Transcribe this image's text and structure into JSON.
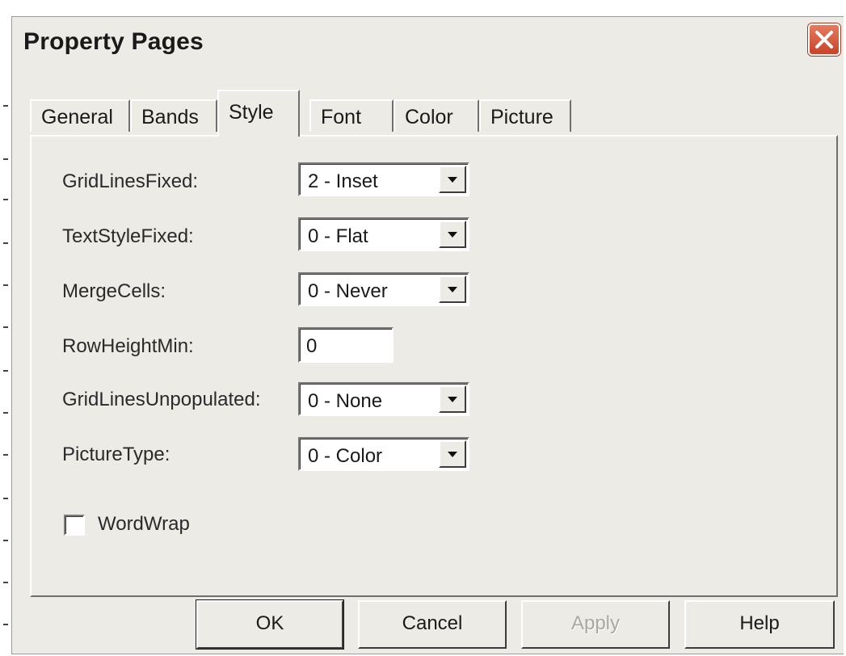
{
  "window": {
    "title": "Property Pages"
  },
  "tabs": [
    {
      "label": "General",
      "active": false
    },
    {
      "label": "Bands",
      "active": false
    },
    {
      "label": "Style",
      "active": true
    },
    {
      "label": "Font",
      "active": false
    },
    {
      "label": "Color",
      "active": false
    },
    {
      "label": "Picture",
      "active": false
    }
  ],
  "style_page": {
    "grid_lines_fixed": {
      "label": "GridLinesFixed:",
      "value": "2 - Inset"
    },
    "text_style_fixed": {
      "label": "TextStyleFixed:",
      "value": "0 - Flat"
    },
    "merge_cells": {
      "label": "MergeCells:",
      "value": "0 - Never"
    },
    "row_height_min": {
      "label": "RowHeightMin:",
      "value": "0"
    },
    "grid_lines_unpopulated": {
      "label": "GridLinesUnpopulated:",
      "value": "0 - None"
    },
    "picture_type": {
      "label": "PictureType:",
      "value": "0 - Color"
    },
    "word_wrap": {
      "label": "WordWrap",
      "checked": false
    }
  },
  "buttons": {
    "ok": "OK",
    "cancel": "Cancel",
    "apply": "Apply",
    "help": "Help"
  },
  "colors": {
    "dialog_bg": "#ecebe6",
    "close_button": "#c8432a",
    "disabled_text": "#a9a8a3"
  },
  "icons": {
    "close": "close-icon",
    "dropdown": "chevron-down-icon"
  }
}
